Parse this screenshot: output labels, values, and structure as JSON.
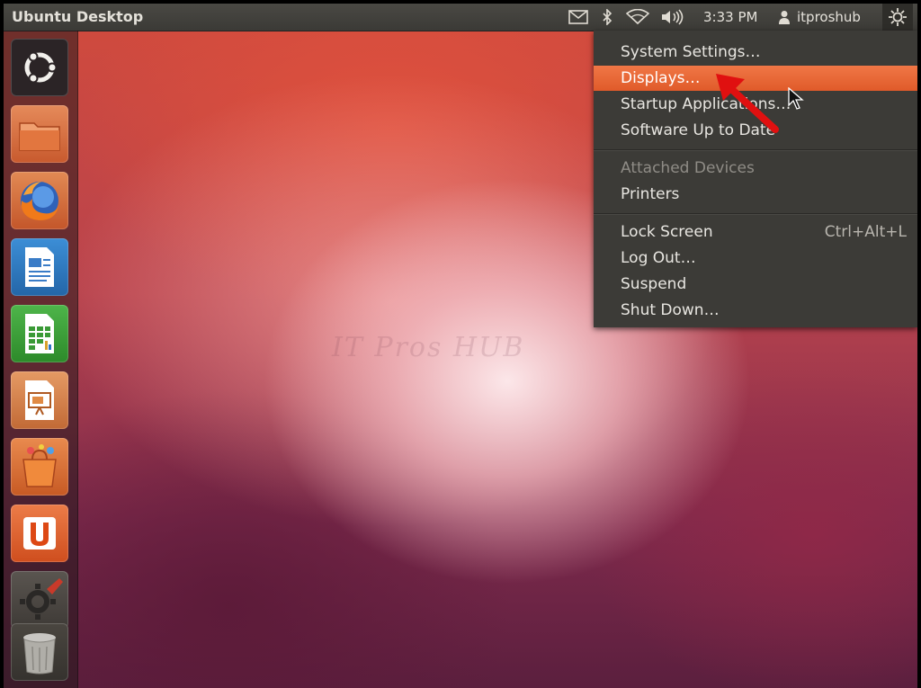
{
  "panel": {
    "title": "Ubuntu Desktop",
    "clock": "3:33 PM",
    "username": "itproshub",
    "indicators": [
      "mail-icon",
      "bluetooth-icon",
      "wifi-icon",
      "volume-icon",
      "user-icon",
      "gear-icon"
    ]
  },
  "launcher": {
    "items": [
      {
        "name": "dash-home",
        "icon": "ubuntu-logo-icon"
      },
      {
        "name": "home-folder",
        "icon": "folder-icon"
      },
      {
        "name": "firefox",
        "icon": "firefox-icon"
      },
      {
        "name": "libreoffice-writer",
        "icon": "writer-icon"
      },
      {
        "name": "libreoffice-calc",
        "icon": "calc-icon"
      },
      {
        "name": "libreoffice-impress",
        "icon": "impress-icon"
      },
      {
        "name": "ubuntu-software-center",
        "icon": "software-center-icon"
      },
      {
        "name": "ubuntu-one",
        "icon": "ubuntu-one-icon"
      },
      {
        "name": "system-settings",
        "icon": "settings-icon"
      },
      {
        "name": "trash",
        "icon": "trash-icon"
      }
    ]
  },
  "menu": {
    "system_settings": "System Settings…",
    "displays": "Displays…",
    "startup_applications": "Startup Applications…",
    "software_up_to_date": "Software Up to Date",
    "attached_devices": "Attached Devices",
    "printers": "Printers",
    "lock_screen": "Lock Screen",
    "lock_screen_shortcut": "Ctrl+Alt+L",
    "log_out": "Log Out…",
    "suspend": "Suspend",
    "shut_down": "Shut Down…"
  },
  "watermark": "IT Pros HUB",
  "colors": {
    "menu_highlight": "#e9622f",
    "annotation_arrow": "#e01010",
    "panel_bg": "#3c3b37"
  }
}
